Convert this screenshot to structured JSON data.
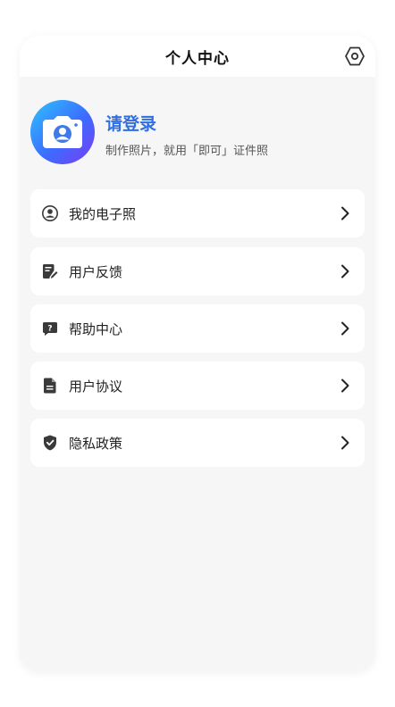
{
  "header": {
    "title": "个人中心"
  },
  "profile": {
    "login_label": "请登录",
    "subtitle": "制作照片，就用「即可」证件照"
  },
  "menu": [
    {
      "label": "我的电子照",
      "icon": "user-circle-icon"
    },
    {
      "label": "用户反馈",
      "icon": "feedback-icon"
    },
    {
      "label": "帮助中心",
      "icon": "help-icon"
    },
    {
      "label": "用户协议",
      "icon": "document-icon"
    },
    {
      "label": "隐私政策",
      "icon": "shield-check-icon"
    }
  ],
  "colors": {
    "accent": "#2f6fe4",
    "background": "#f6f6f6",
    "card": "#ffffff",
    "icon": "#3a3a3a"
  }
}
